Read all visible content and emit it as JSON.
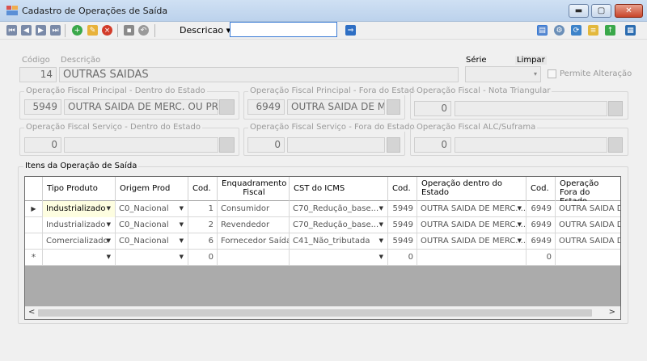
{
  "window": {
    "title": "Cadastro de Operações de Saída",
    "minimize_glyph": "▬",
    "maximize_glyph": "▢",
    "close_glyph": "✕"
  },
  "toolbar": {
    "dropdown_label": "Descricao",
    "dropdown_arrow": "▾",
    "search_value": "",
    "icons": [
      "first-icon",
      "prev-icon",
      "next-icon",
      "last-icon",
      "add-icon",
      "edit-icon",
      "delete-icon",
      "save-icon",
      "undo-icon",
      "search-go-icon",
      "report-icon",
      "settings-icon",
      "refresh-icon",
      "document-icon",
      "export-icon",
      "grid-icon"
    ]
  },
  "header": {
    "codigo_label": "Código",
    "codigo_value": "14",
    "descricao_label": "Descrição",
    "descricao_value": "OUTRAS SAIDAS",
    "serie_label": "Série",
    "limpar_label": "Limpar",
    "serie_value": "",
    "permite_alteracao_label": "Permite Alteração",
    "permite_alteracao_checked": false
  },
  "groups": [
    {
      "title": "Operação Fiscal Principal - Dentro do Estado",
      "code": "5949",
      "desc": "OUTRA SAIDA DE MERC. OU PR"
    },
    {
      "title": "Operação Fiscal Principal - Fora do Estado",
      "code": "6949",
      "desc": "OUTRA SAIDA DE M"
    },
    {
      "title": "Operação Fiscal - Nota Triangular",
      "code": "0",
      "desc": ""
    },
    {
      "title": "Operação Fiscal Serviço - Dentro do Estado",
      "code": "0",
      "desc": ""
    },
    {
      "title": "Operação Fiscal Serviço - Fora do Estado",
      "code": "0",
      "desc": ""
    },
    {
      "title": "Operação Fiscal ALC/Suframa",
      "code": "0",
      "desc": ""
    }
  ],
  "items": {
    "title": "Itens da Operação de Saída",
    "columns": [
      "Tipo Produto",
      "Origem Prod",
      "Cod.",
      "Enquadramento Fiscal",
      "CST do ICMS",
      "Cod.",
      "Operação dentro do Estado",
      "Cod.",
      "Operação Fora do Estado"
    ],
    "rows": [
      {
        "indicator": "▶",
        "tipo": "Industrializado",
        "origem": "C0_Nacional",
        "cod1": "1",
        "enq": "Consumidor",
        "cst": "C70_Redução_base...",
        "cod2": "5949",
        "op_dentro": "OUTRA SAIDA DE MERC. ...",
        "cod3": "6949",
        "op_fora": "OUTRA SAIDA DE"
      },
      {
        "indicator": "",
        "tipo": "Industrializado",
        "origem": "C0_Nacional",
        "cod1": "2",
        "enq": "Revendedor",
        "cst": "C70_Redução_base...",
        "cod2": "5949",
        "op_dentro": "OUTRA SAIDA DE MERC. ...",
        "cod3": "6949",
        "op_fora": "OUTRA SAIDA DE"
      },
      {
        "indicator": "",
        "tipo": "Comercializado",
        "origem": "C0_Nacional",
        "cod1": "6",
        "enq": "Fornecedor Saída",
        "cst": "C41_Não_tributada",
        "cod2": "5949",
        "op_dentro": "OUTRA SAIDA DE MERC. ...",
        "cod3": "6949",
        "op_fora": "OUTRA SAIDA DE"
      },
      {
        "indicator": "*",
        "tipo": "",
        "origem": "",
        "cod1": "0",
        "enq": "",
        "cst": "",
        "cod2": "0",
        "op_dentro": "",
        "cod3": "0",
        "op_fora": ""
      }
    ],
    "scroll_left": "<",
    "scroll_right": ">"
  },
  "colors": {
    "accent": "#3a7bd5",
    "title_bar": "#c8dbf1",
    "selected_cell": "#fdfde0"
  }
}
